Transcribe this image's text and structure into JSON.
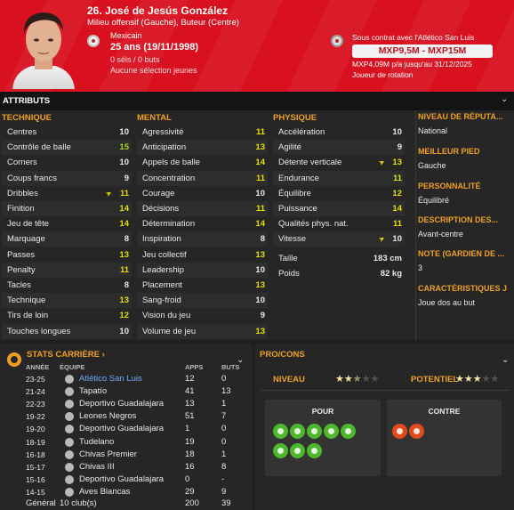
{
  "player": {
    "name": "26. José de Jesús González",
    "role": "Milieu offensif (Gauche), Buteur (Centre)",
    "nationality": "Mexicain",
    "age": "25 ans",
    "birthdate": "(19/11/1998)",
    "caps": "0 séls / 0 buts",
    "youth_caps": "Aucune sélection jeunes"
  },
  "contract": {
    "text": "Sous contrat avec l'Atlético San Luis",
    "value": "MXP9,5M - MXP15M",
    "wage": "MXP4,09M p/a jusqu'au 31/12/2025",
    "squad_role": "Joueur de rotation"
  },
  "attributes": {
    "title": "ATTRIBUTS",
    "technique_title": "TECHNIQUE",
    "mental_title": "MENTAL",
    "physique_title": "PHYSIQUE",
    "technique": [
      {
        "label": "Centres",
        "value": "10"
      },
      {
        "label": "Contrôle de balle",
        "value": "15"
      },
      {
        "label": "Corners",
        "value": "10"
      },
      {
        "label": "Coups francs",
        "value": "9"
      },
      {
        "label": "Dribbles",
        "value": "11"
      },
      {
        "label": "Finition",
        "value": "14"
      },
      {
        "label": "Jeu de tête",
        "value": "14"
      },
      {
        "label": "Marquage",
        "value": "8"
      },
      {
        "label": "Passes",
        "value": "13"
      },
      {
        "label": "Penalty",
        "value": "11"
      },
      {
        "label": "Tacles",
        "value": "8"
      },
      {
        "label": "Technique",
        "value": "13"
      },
      {
        "label": "Tirs de loin",
        "value": "12"
      },
      {
        "label": "Touches longues",
        "value": "10"
      }
    ],
    "mental": [
      {
        "label": "Agressivité",
        "value": "11"
      },
      {
        "label": "Anticipation",
        "value": "13"
      },
      {
        "label": "Appels de balle",
        "value": "14"
      },
      {
        "label": "Concentration",
        "value": "11"
      },
      {
        "label": "Courage",
        "value": "10"
      },
      {
        "label": "Décisions",
        "value": "11"
      },
      {
        "label": "Détermination",
        "value": "14"
      },
      {
        "label": "Inspiration",
        "value": "8"
      },
      {
        "label": "Jeu collectif",
        "value": "13"
      },
      {
        "label": "Leadership",
        "value": "10"
      },
      {
        "label": "Placement",
        "value": "13"
      },
      {
        "label": "Sang-froid",
        "value": "10"
      },
      {
        "label": "Vision du jeu",
        "value": "9"
      },
      {
        "label": "Volume de jeu",
        "value": "13"
      }
    ],
    "physique": [
      {
        "label": "Accélération",
        "value": "10"
      },
      {
        "label": "Agilité",
        "value": "9"
      },
      {
        "label": "Détente verticale",
        "value": "13"
      },
      {
        "label": "Endurance",
        "value": "11"
      },
      {
        "label": "Équilibre",
        "value": "12"
      },
      {
        "label": "Puissance",
        "value": "14"
      },
      {
        "label": "Qualités phys. nat.",
        "value": "11"
      },
      {
        "label": "Vitesse",
        "value": "10"
      }
    ],
    "height_label": "Taille",
    "height": "183 cm",
    "weight_label": "Poids",
    "weight": "82 kg"
  },
  "info": {
    "reputation_title": "NIVEAU DE RÉPUTA...",
    "reputation": "National",
    "foot_title": "MEILLEUR PIED",
    "foot": "Gauche",
    "personality_title": "PERSONNALITÉ",
    "personality": "Équilibré",
    "description_title": "DESCRIPTION DES...",
    "description": "Avant-centre",
    "goalkeeper_title": "NOTE (GARDIEN DE ...",
    "goalkeeper": "3",
    "traits_title": "CARACTÉRISTIQUES J",
    "traits": "Joue dos au but"
  },
  "career": {
    "title": "STATS CARRIÈRE",
    "col_season": "ANNÉE",
    "col_team": "ÉQUIPE",
    "col_apps": "APPS",
    "col_goals": "BUTS",
    "rows": [
      {
        "season": "23-25",
        "team": "Atlético San Luis",
        "apps": "12",
        "goals": "0"
      },
      {
        "season": "21-24",
        "team": "Tapatío",
        "apps": "41",
        "goals": "13"
      },
      {
        "season": "22-23",
        "team": "Deportivo Guadalajara",
        "apps": "13",
        "goals": "1"
      },
      {
        "season": "19-22",
        "team": "Leones Negros",
        "apps": "51",
        "goals": "7"
      },
      {
        "season": "19-20",
        "team": "Deportivo Guadalajara",
        "apps": "1",
        "goals": "0"
      },
      {
        "season": "18-19",
        "team": "Tudelano",
        "apps": "19",
        "goals": "0"
      },
      {
        "season": "16-18",
        "team": "Chivas Premier",
        "apps": "18",
        "goals": "1"
      },
      {
        "season": "15-17",
        "team": "Chivas III",
        "apps": "16",
        "goals": "8"
      },
      {
        "season": "15-16",
        "team": "Deportivo Guadalajara",
        "apps": "0",
        "goals": "-"
      },
      {
        "season": "14-15",
        "team": "Aves Blancas",
        "apps": "29",
        "goals": "9"
      }
    ],
    "total": {
      "label": "Général",
      "team": "10 club(s)",
      "apps": "200",
      "goals": "39"
    }
  },
  "proscons": {
    "title": "PRO/CONS",
    "level_label": "NIVEAU",
    "level_stars": 2.5,
    "potential_label": "POTENTIEL",
    "potential_stars": 3,
    "pros_title": "POUR",
    "cons_title": "CONTRE"
  },
  "colors": {
    "header_red": "#d8101f",
    "accent_orange": "#f0a020",
    "attr_yellow": "#e6e000",
    "attr_green": "#a8d22a",
    "link_blue": "#6fa8ff"
  }
}
